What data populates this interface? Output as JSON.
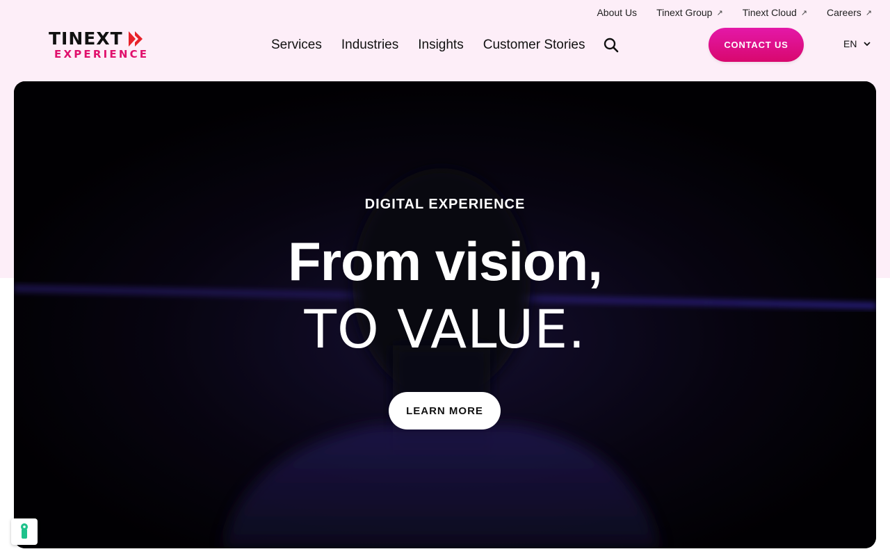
{
  "utility_nav": [
    {
      "label": "About Us",
      "external": false
    },
    {
      "label": "Tinext Group",
      "external": true
    },
    {
      "label": "Tinext Cloud",
      "external": true
    },
    {
      "label": "Careers",
      "external": true
    }
  ],
  "logo": {
    "top": "TINEXT",
    "bottom": "EXPERIENCE"
  },
  "main_nav": [
    "Services",
    "Industries",
    "Insights",
    "Customer Stories"
  ],
  "contact_button": "CONTACT US",
  "language": "EN",
  "hero": {
    "eyebrow": "DIGITAL EXPERIENCE",
    "headline": "From vision,",
    "subheadline": "TO VALUE.",
    "cta": "LEARN MORE"
  },
  "colors": {
    "header_background": "#fdeef8",
    "brand_pink": "#e0106c",
    "brand_red": "#e8222a",
    "contact_gradient": [
      "#e418a8",
      "#d8086e"
    ],
    "hero_background": "#040208",
    "cookie_icon": "#1ec28b"
  },
  "icons": [
    "external-arrow-icon",
    "search-icon",
    "chevron-down-icon",
    "cookie-settings-icon",
    "logo-arrows-icon"
  ]
}
